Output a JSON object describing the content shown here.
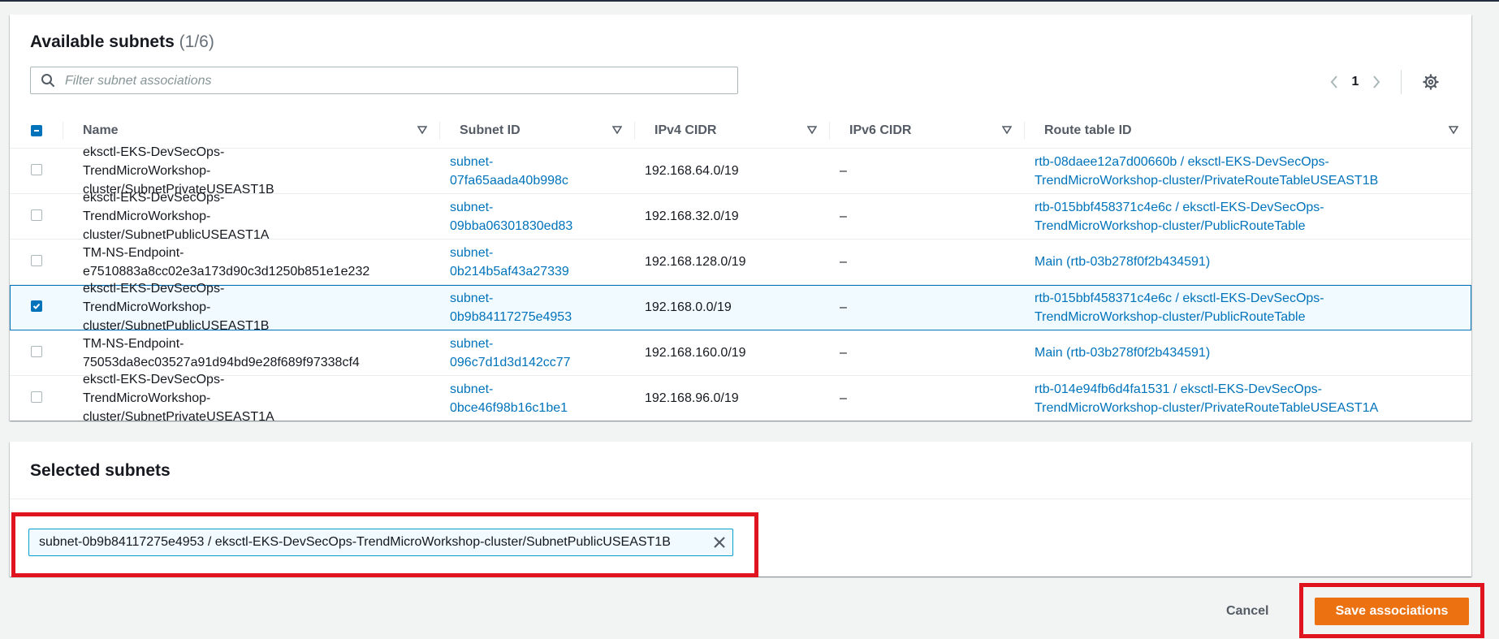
{
  "available": {
    "title": "Available subnets",
    "count": "(1/6)",
    "filter_placeholder": "Filter subnet associations",
    "page": "1",
    "columns": [
      "Name",
      "Subnet ID",
      "IPv4 CIDR",
      "IPv6 CIDR",
      "Route table ID"
    ],
    "rows": [
      {
        "name_1": "eksctl-EKS-DevSecOps-TrendMicroWorkshop-",
        "name_2": "cluster/SubnetPrivateUSEAST1B",
        "sub_1": "subnet-",
        "sub_2": "07fa65aada40b998c",
        "ipv4": "192.168.64.0/19",
        "ipv6": "–",
        "rt_1": "rtb-08daee12a7d00660b / eksctl-EKS-DevSecOps-",
        "rt_2": "TrendMicroWorkshop-cluster/PrivateRouteTableUSEAST1B",
        "checked": false
      },
      {
        "name_1": "eksctl-EKS-DevSecOps-TrendMicroWorkshop-",
        "name_2": "cluster/SubnetPublicUSEAST1A",
        "sub_1": "subnet-",
        "sub_2": "09bba06301830ed83",
        "ipv4": "192.168.32.0/19",
        "ipv6": "–",
        "rt_1": "rtb-015bbf458371c4e6c / eksctl-EKS-DevSecOps-",
        "rt_2": "TrendMicroWorkshop-cluster/PublicRouteTable",
        "checked": false
      },
      {
        "name_1": "TM-NS-Endpoint-",
        "name_2": "e7510883a8cc02e3a173d90c3d1250b851e1e232",
        "sub_1": "subnet-",
        "sub_2": "0b214b5af43a27339",
        "ipv4": "192.168.128.0/19",
        "ipv6": "–",
        "rt_1": "Main (rtb-03b278f0f2b434591)",
        "rt_2": "",
        "checked": false
      },
      {
        "name_1": "eksctl-EKS-DevSecOps-TrendMicroWorkshop-",
        "name_2": "cluster/SubnetPublicUSEAST1B",
        "sub_1": "subnet-",
        "sub_2": "0b9b84117275e4953",
        "ipv4": "192.168.0.0/19",
        "ipv6": "–",
        "rt_1": "rtb-015bbf458371c4e6c / eksctl-EKS-DevSecOps-",
        "rt_2": "TrendMicroWorkshop-cluster/PublicRouteTable",
        "checked": true
      },
      {
        "name_1": "TM-NS-Endpoint-",
        "name_2": "75053da8ec03527a91d94bd9e28f689f97338cf4",
        "sub_1": "subnet-",
        "sub_2": "096c7d1d3d142cc77",
        "ipv4": "192.168.160.0/19",
        "ipv6": "–",
        "rt_1": "Main (rtb-03b278f0f2b434591)",
        "rt_2": "",
        "checked": false
      },
      {
        "name_1": "eksctl-EKS-DevSecOps-TrendMicroWorkshop-",
        "name_2": "cluster/SubnetPrivateUSEAST1A",
        "sub_1": "subnet-",
        "sub_2": "0bce46f98b16c1be1",
        "ipv4": "192.168.96.0/19",
        "ipv6": "–",
        "rt_1": "rtb-014e94fb6d4fa1531 / eksctl-EKS-DevSecOps-",
        "rt_2": "TrendMicroWorkshop-cluster/PrivateRouteTableUSEAST1A",
        "checked": false
      }
    ]
  },
  "selected": {
    "title": "Selected subnets",
    "token": "subnet-0b9b84117275e4953 / eksctl-EKS-DevSecOps-TrendMicroWorkshop-cluster/SubnetPublicUSEAST1B"
  },
  "actions": {
    "cancel": "Cancel",
    "save": "Save associations"
  },
  "colors": {
    "link": "#0073bb",
    "primary_button": "#ec7211",
    "highlight": "#e0141e"
  }
}
